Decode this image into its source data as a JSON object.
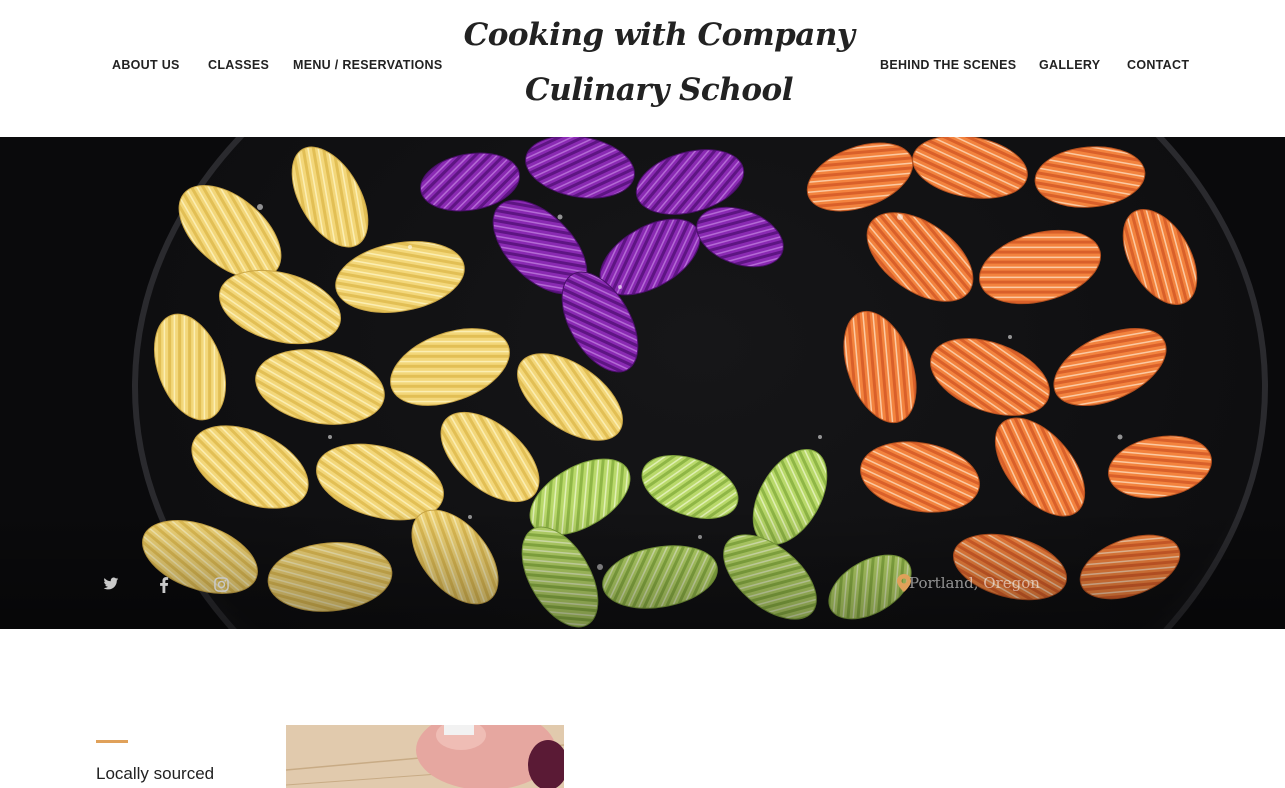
{
  "brand": {
    "line1": "Cooking with Company",
    "line2": "Culinary School"
  },
  "nav_left": [
    {
      "label": "ABOUT US"
    },
    {
      "label": "CLASSES"
    },
    {
      "label": "MENU / RESERVATIONS"
    }
  ],
  "nav_right": [
    {
      "label": "BEHIND THE SCENES"
    },
    {
      "label": "GALLERY"
    },
    {
      "label": "CONTACT"
    }
  ],
  "hero": {
    "image": "colorful-gnocchi-pasta-photo",
    "social_icons": [
      "twitter-icon",
      "facebook-icon",
      "instagram-icon"
    ],
    "location_icon": "map-pin-icon",
    "location": "Portland, Oregon"
  },
  "feature": {
    "title": "Locally sourced",
    "image": "hands-cutting-dough-photo"
  },
  "colors": {
    "accent": "#e0a15a",
    "text": "#222222",
    "background": "#ffffff"
  }
}
